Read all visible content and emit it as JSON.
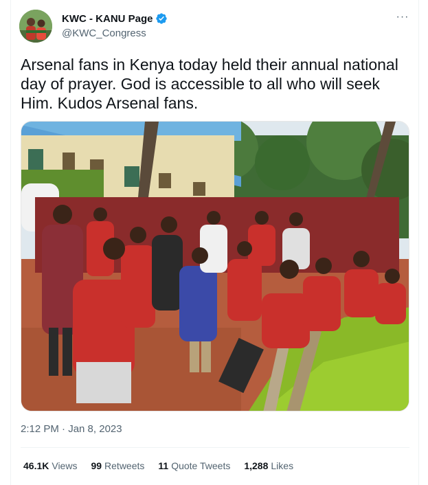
{
  "author": {
    "display_name": "KWC - KANU Page",
    "handle": "@KWC_Congress",
    "avatar_icon": "profile-photo",
    "verified_icon": "verified-badge-icon"
  },
  "menu": {
    "more_label": "···"
  },
  "tweet": {
    "text": "Arsenal fans in Kenya today held their annual national day of prayer. God is accessible to all who will seek Him. Kudos Arsenal fans.",
    "timestamp": "2:12 PM · Jan 8, 2023"
  },
  "stats": {
    "views": {
      "count": "46.1K",
      "label": "Views"
    },
    "retweets": {
      "count": "99",
      "label": "Retweets"
    },
    "quote_tweets": {
      "count": "11",
      "label": "Quote Tweets"
    },
    "likes": {
      "count": "1,288",
      "label": "Likes"
    }
  },
  "colors": {
    "text_primary": "#0f1419",
    "text_secondary": "#536471",
    "verified_blue": "#1d9bf0",
    "divider": "#eff3f4"
  }
}
